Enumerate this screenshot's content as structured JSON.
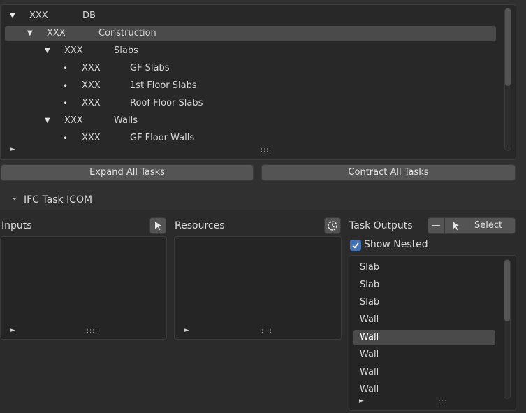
{
  "tree": {
    "rows": [
      {
        "glyph": "▼",
        "code": "XXX",
        "name": "DB"
      },
      {
        "glyph": "▼",
        "code": "XXX",
        "name": "Construction"
      },
      {
        "glyph": "▼",
        "code": "XXX",
        "name": "Slabs"
      },
      {
        "glyph": "•",
        "code": "XXX",
        "name": "GF Slabs"
      },
      {
        "glyph": "•",
        "code": "XXX",
        "name": "1st Floor Slabs"
      },
      {
        "glyph": "•",
        "code": "XXX",
        "name": "Roof Floor Slabs"
      },
      {
        "glyph": "▼",
        "code": "XXX",
        "name": "Walls"
      },
      {
        "glyph": "•",
        "code": "XXX",
        "name": "GF Floor Walls"
      }
    ],
    "expand_glyph": "►",
    "grip": "::::"
  },
  "buttons": {
    "expand_all": "Expand All Tasks",
    "contract_all": "Contract All Tasks"
  },
  "panel": {
    "chevron": "⌄",
    "title": "IFC Task ICOM"
  },
  "inputs": {
    "label": "Inputs",
    "expand_glyph": "►",
    "grip": "::::"
  },
  "resources": {
    "label": "Resources",
    "expand_glyph": "►",
    "grip": "::::"
  },
  "outputs": {
    "label": "Task Outputs",
    "minus": "—",
    "select_label": "Select",
    "show_nested_label": "Show Nested",
    "show_nested_checked": true,
    "items": [
      "Slab",
      "Slab",
      "Slab",
      "Wall",
      "Wall",
      "Wall",
      "Wall",
      "Wall"
    ],
    "selected_index": 4,
    "expand_glyph": "►",
    "grip": "::::"
  },
  "colors": {
    "background": "#303030",
    "list_background": "#282828",
    "selection": "#4a4a4a",
    "button": "#545454",
    "checkbox": "#4772b3"
  }
}
